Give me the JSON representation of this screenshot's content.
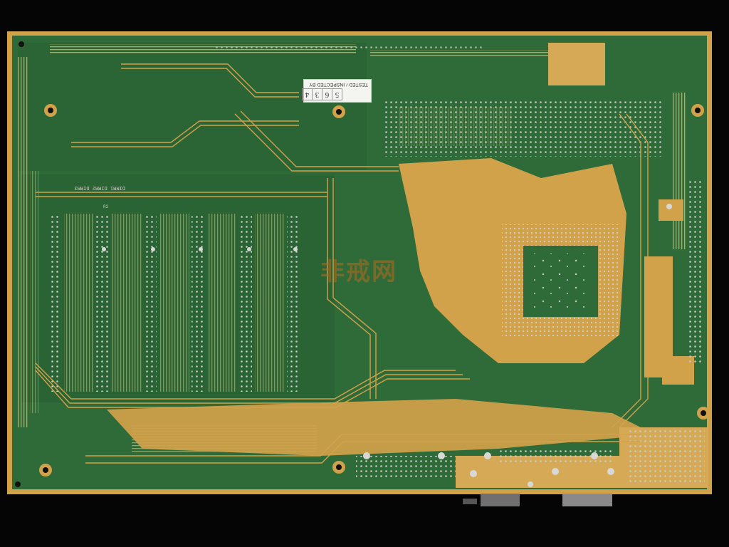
{
  "photo": {
    "subject": "motherboard-back-pcb",
    "colors": {
      "background": "#050505",
      "solder_mask": "#2f6b38",
      "solder_mask_dark": "#245a2c",
      "copper_gold": "#d2a24a",
      "copper_light": "#dbaf5a",
      "pin_silver": "#c9cbc6"
    }
  },
  "sticker": {
    "label": "TESTED / INSPECTED BY",
    "digits": [
      "5",
      "6",
      "3",
      "4"
    ]
  },
  "silkscreen": {
    "row_label": "DIMM1 DIMM2 DIMM3",
    "small_label": "R2"
  },
  "watermark": {
    "top": "",
    "main": "非戒网",
    "url": ""
  }
}
